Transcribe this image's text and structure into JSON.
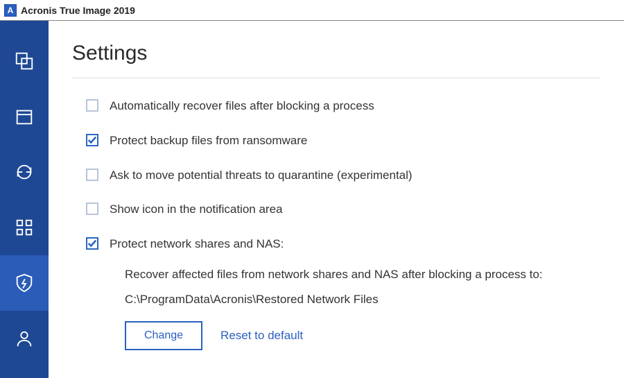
{
  "app": {
    "title": "Acronis True Image 2019",
    "logo_letter": "A"
  },
  "page": {
    "title": "Settings"
  },
  "options": {
    "auto_recover": {
      "label": "Automatically recover files after blocking a process",
      "checked": false
    },
    "protect_backup": {
      "label": "Protect backup files from ransomware",
      "checked": true
    },
    "quarantine": {
      "label": "Ask to move potential threats to quarantine (experimental)",
      "checked": false
    },
    "tray_icon": {
      "label": "Show icon in the notification area",
      "checked": false
    },
    "protect_nas": {
      "label": "Protect network shares and NAS:",
      "checked": true
    }
  },
  "nas": {
    "description": "Recover affected files from network shares and NAS after blocking a process to:",
    "path": "C:\\ProgramData\\Acronis\\Restored Network Files",
    "change_label": "Change",
    "reset_label": "Reset to default"
  },
  "sidebar": {
    "items": [
      {
        "name": "backup",
        "active": false
      },
      {
        "name": "archive",
        "active": false
      },
      {
        "name": "sync",
        "active": false
      },
      {
        "name": "tools",
        "active": false
      },
      {
        "name": "active-protection",
        "active": true
      },
      {
        "name": "account",
        "active": false
      }
    ]
  }
}
